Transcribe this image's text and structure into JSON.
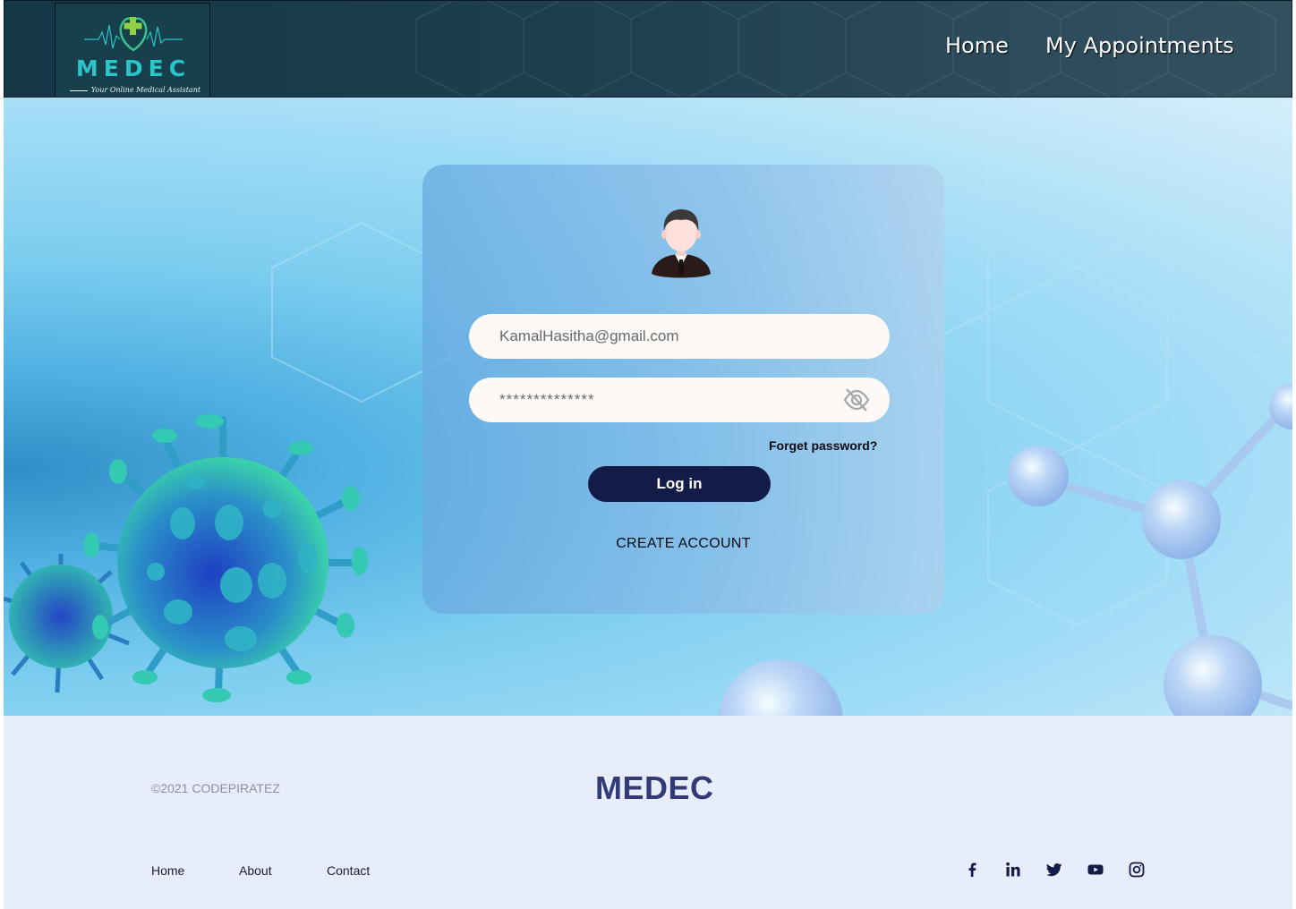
{
  "header": {
    "logo_title": "MEDEC",
    "logo_tagline": "Your Online Medical Assistant",
    "nav": [
      {
        "label": "Home"
      },
      {
        "label": "My Appointments"
      }
    ]
  },
  "login": {
    "email_value": "KamalHasitha@gmail.com",
    "password_value": "**************",
    "forgot_label": "Forget password?",
    "login_label": "Log in",
    "create_label": "CREATE ACCOUNT"
  },
  "footer": {
    "copyright": "©2021 CODEPIRATEZ",
    "brand": "MEDEC",
    "links": [
      {
        "label": "Home"
      },
      {
        "label": "About"
      },
      {
        "label": "Contact"
      }
    ],
    "social_icons": [
      "facebook-icon",
      "linkedin-icon",
      "twitter-icon",
      "youtube-icon",
      "instagram-icon"
    ]
  },
  "colors": {
    "header_bg": "#1d3f4f",
    "logo_teal": "#2bc4c9",
    "button_navy": "#131b47",
    "footer_bg": "#e8edfc",
    "footer_brand": "#323a78"
  }
}
